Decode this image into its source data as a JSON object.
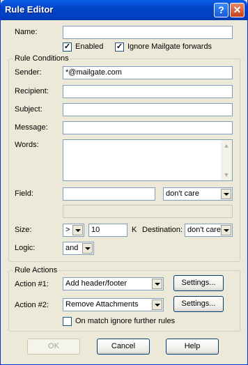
{
  "window": {
    "title": "Rule Editor",
    "help_glyph": "?",
    "close_glyph": "✕"
  },
  "name": {
    "label": "Name:",
    "value": ""
  },
  "enabled": {
    "label": "Enabled",
    "checked": true
  },
  "ignore_mailgate": {
    "label": "Ignore Mailgate forwards",
    "checked": true
  },
  "conditions": {
    "group_title": "Rule Conditions",
    "sender": {
      "label": "Sender:",
      "value": "*@mailgate.com"
    },
    "recipient": {
      "label": "Recipient:",
      "value": ""
    },
    "subject": {
      "label": "Subject:",
      "value": ""
    },
    "message": {
      "label": "Message:",
      "value": ""
    },
    "words": {
      "label": "Words:",
      "value": ""
    },
    "field": {
      "label": "Field:",
      "value": "",
      "match": "don't care",
      "extra": ""
    },
    "size": {
      "label": "Size:",
      "operator": ">",
      "value": "10",
      "unit": "K"
    },
    "destination": {
      "label": "Destination:",
      "value": "don't care"
    },
    "logic": {
      "label": "Logic:",
      "value": "and"
    }
  },
  "actions": {
    "group_title": "Rule Actions",
    "action1": {
      "label": "Action #1:",
      "value": "Add header/footer",
      "settings": "Settings..."
    },
    "action2": {
      "label": "Action #2:",
      "value": "Remove Attachments",
      "settings": "Settings..."
    },
    "ignore_further": {
      "label": "On match ignore further rules",
      "checked": false
    }
  },
  "buttons": {
    "ok": "OK",
    "cancel": "Cancel",
    "help": "Help"
  },
  "check_glyph": "✓",
  "scroll": {
    "up": "▲",
    "down": "▼"
  }
}
